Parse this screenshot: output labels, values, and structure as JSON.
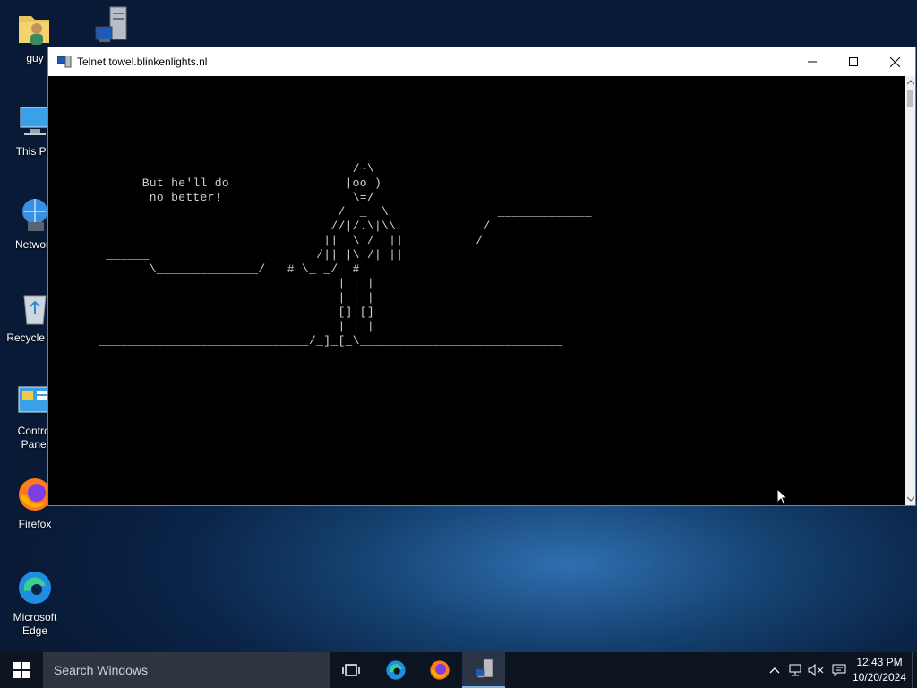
{
  "desktop": {
    "icons": [
      {
        "label": "guy"
      },
      {
        "label": ""
      },
      {
        "label": "This PC"
      },
      {
        "label": "Network"
      },
      {
        "label": "Recycle Bin"
      },
      {
        "label": "Control Panel"
      },
      {
        "label": "Firefox"
      },
      {
        "label": "Microsoft Edge"
      }
    ]
  },
  "window": {
    "title": "Telnet towel.blinkenlights.nl",
    "console_text": "                                    /~\\\n       But he'll do                |oo )\n        no better!                 _\\=/_\n                                  /  _  \\               _____________\n                                 //|/.\\|\\\\            /\n                                ||_ \\_/ _||_________ /\n  ______                       /|| |\\ /| ||\n        \\______________/   # \\_ _/  #\n                                  | | |\n                                  | | |\n                                  []|[]\n                                  | | |\n _____________________________/_]_[_\\____________________________"
  },
  "taskbar": {
    "search_placeholder": "Search Windows",
    "time": "12:43 PM",
    "date": "10/20/2024"
  },
  "colors": {
    "accent": "#7fb0e6",
    "console_bg": "#000000",
    "console_fg": "#d0d0d0",
    "taskbar_bg": "#0c1420"
  }
}
